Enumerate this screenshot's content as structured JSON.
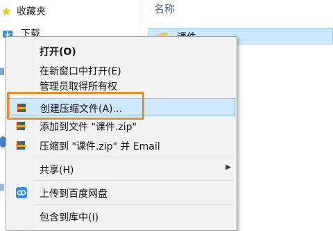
{
  "nav": {
    "favorites_label": "收藏夹",
    "downloads_label": "下载"
  },
  "main": {
    "column_name_header": "名称",
    "selected_file_name": "课件"
  },
  "context_menu": {
    "items": [
      {
        "label": "打开(O)"
      },
      {
        "label": "在新窗口中打开(E)"
      },
      {
        "label": "管理员取得所有权"
      },
      {
        "label": "创建压缩文件(A)..."
      },
      {
        "label": "添加到文件 \"课件.zip\""
      },
      {
        "label": "压缩到 \"课件.zip\" 并 Email"
      },
      {
        "label": "共享(H)"
      },
      {
        "label": "上传到百度网盘"
      },
      {
        "label": "包含到库中(I)"
      }
    ]
  },
  "colors": {
    "highlight_box": "#f08a24",
    "selection_bg": "#cce8ff"
  },
  "icons": {
    "archive_icon": "winrar-books-icon",
    "baidu_icon": "baidu-netdisk-icon",
    "folder_icon": "folder-icon"
  }
}
